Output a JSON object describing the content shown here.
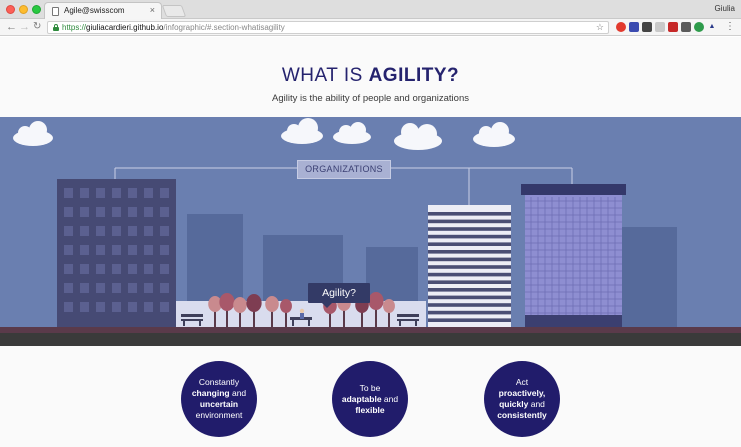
{
  "browser": {
    "tab_title": "Agile@swisscom",
    "tab_close": "×",
    "profile_name": "Giulia",
    "url_scheme": "https://",
    "url_host": "giuliacardieri.github.io",
    "url_path": "/infographic/#.section-whatisagility",
    "icons": [
      "back-arrow-icon",
      "forward-arrow-icon",
      "reload-icon",
      "lock-icon",
      "star-icon",
      "menu-dots-icon"
    ]
  },
  "hero": {
    "title_prefix": "WHAT IS ",
    "title_bold": "AGILITY?",
    "subtitle": "Agility is the ability of people and organizations"
  },
  "scene": {
    "org_label": "ORGANIZATIONS",
    "bubble_label": "Agility?",
    "colors": {
      "sky": "#6a7fb0",
      "ground": "#5a3a4a",
      "road": "#3a3a3a",
      "accent": "#211c6b"
    }
  },
  "traits": [
    {
      "line1": "Constantly",
      "bold1": "changing",
      "mid1": " and",
      "bold2": "uncertain",
      "line3": "environment"
    },
    {
      "line1": "To be",
      "bold1": "adaptable",
      "mid1": " and",
      "bold2": "flexible",
      "line3": ""
    },
    {
      "line1": "Act",
      "bold1": "proactively,",
      "mid1": "",
      "bold2": "quickly",
      "mid2": " and",
      "bold3": "consistently"
    }
  ]
}
